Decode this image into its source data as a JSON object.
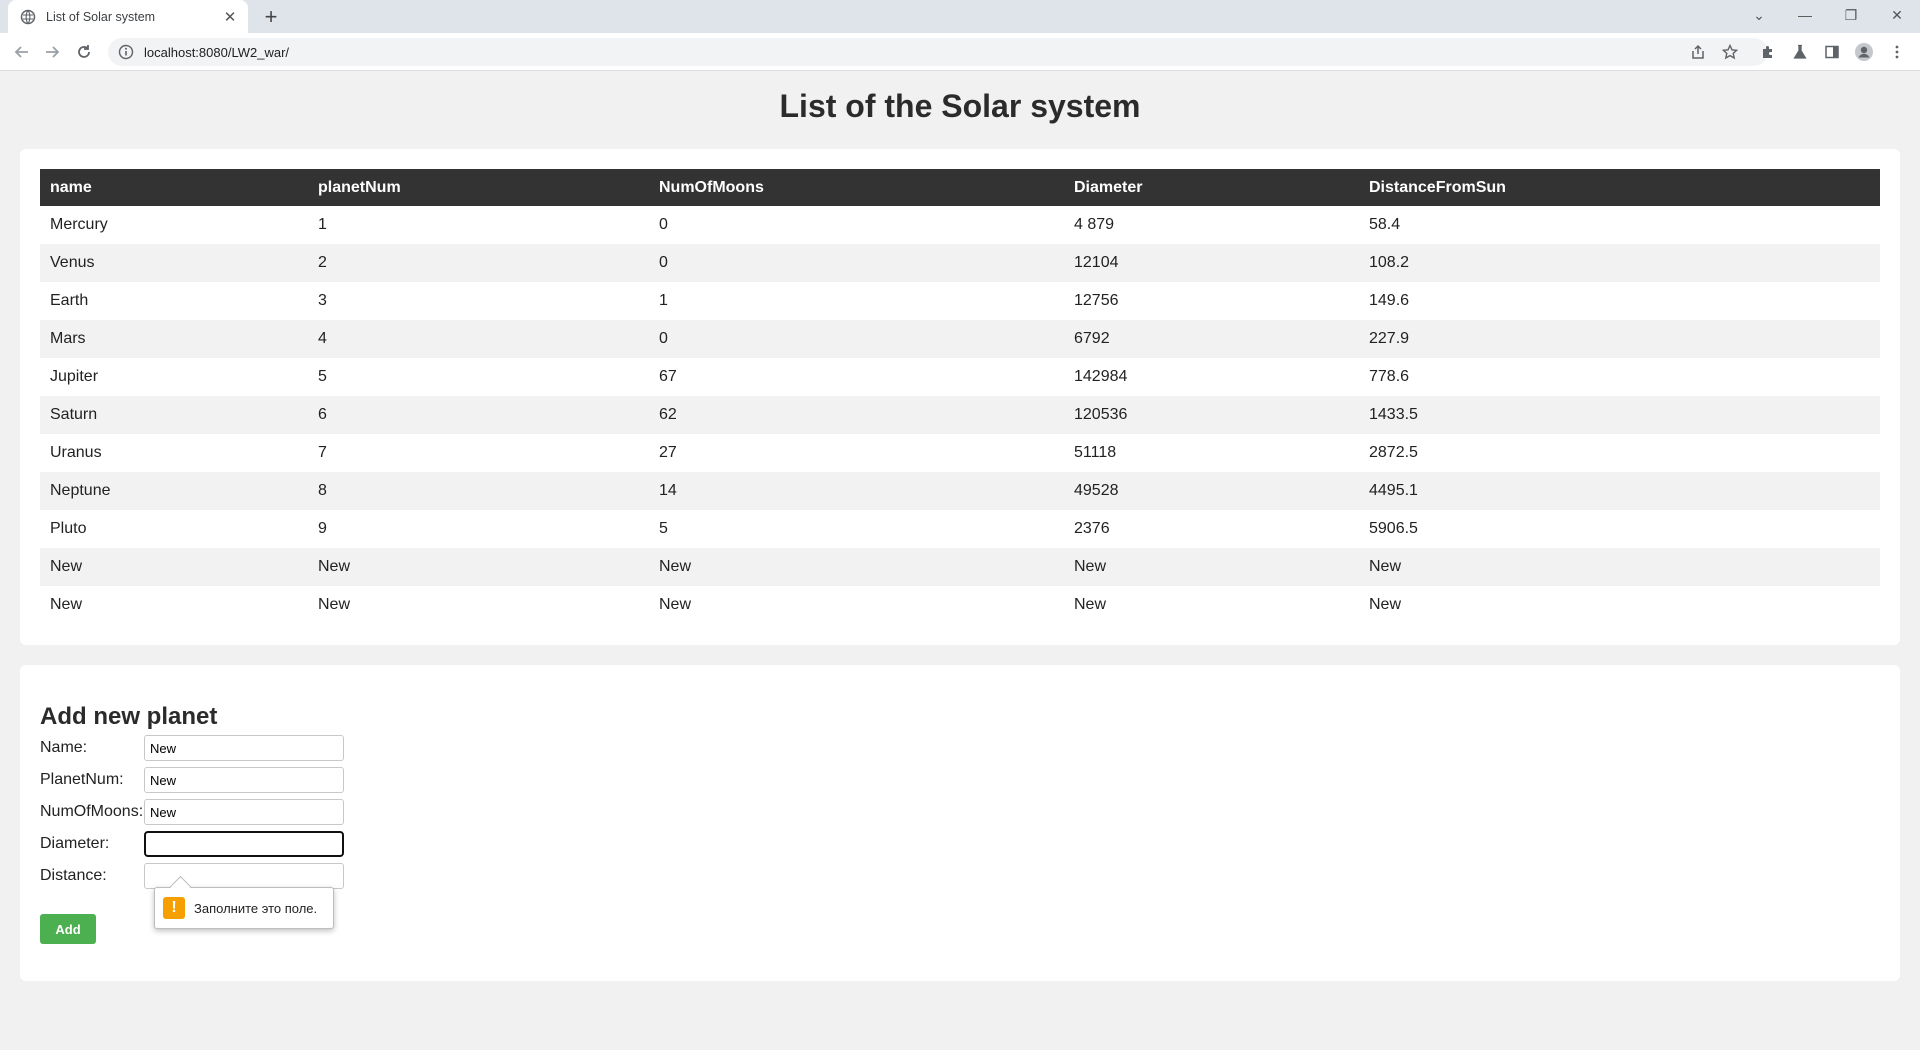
{
  "browser": {
    "tab_title": "List of Solar system",
    "tab_close": "✕",
    "new_tab": "+",
    "url": "localhost:8080/LW2_war/",
    "window": {
      "minimize": "—",
      "restore": "❐",
      "close": "✕",
      "tab_search": "⌄"
    }
  },
  "page": {
    "title": "List of the Solar system"
  },
  "table": {
    "headers": [
      "name",
      "planetNum",
      "NumOfMoons",
      "Diameter",
      "DistanceFromSun"
    ],
    "rows": [
      [
        "Mercury",
        "1",
        "0",
        "4 879",
        "58.4"
      ],
      [
        "Venus",
        "2",
        "0",
        "12104",
        "108.2"
      ],
      [
        "Earth",
        "3",
        "1",
        "12756",
        "149.6"
      ],
      [
        "Mars",
        "4",
        "0",
        "6792",
        "227.9"
      ],
      [
        "Jupiter",
        "5",
        "67",
        "142984",
        "778.6"
      ],
      [
        "Saturn",
        "6",
        "62",
        "120536",
        "1433.5"
      ],
      [
        "Uranus",
        "7",
        "27",
        "51118",
        "2872.5"
      ],
      [
        "Neptune",
        "8",
        "14",
        "49528",
        "4495.1"
      ],
      [
        "Pluto",
        "9",
        "5",
        "2376",
        "5906.5"
      ],
      [
        "New",
        "New",
        "New",
        "New",
        "New"
      ],
      [
        "New",
        "New",
        "New",
        "New",
        "New"
      ]
    ]
  },
  "form": {
    "title": "Add new planet",
    "name_label": "Name:",
    "name_value": "New",
    "planetnum_label": "PlanetNum:",
    "planetnum_value": "New",
    "numofmoons_label": "NumOfMoons:",
    "numofmoons_value": "New",
    "diameter_label": "Diameter:",
    "diameter_value": "",
    "distance_label": "Distance:",
    "distance_value": "",
    "add_label": "Add"
  },
  "validation": {
    "icon": "!",
    "message": "Заполните это поле."
  },
  "colors": {
    "header_bg": "#333333",
    "button_bg": "#4caf50",
    "warning": "#f5a000"
  }
}
